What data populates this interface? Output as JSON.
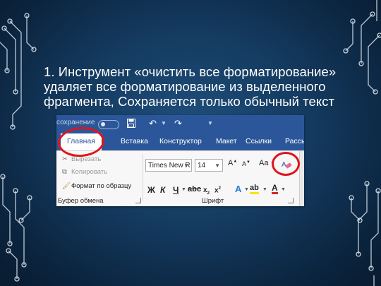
{
  "caption": {
    "line1": "1. Инструмент «очистить все форматирование»",
    "line2": "удаляет все форматирование из выделенного",
    "line3": "фрагмента, Сохраняется только обычный текст"
  },
  "word_ui": {
    "autosave_label": "сохранение",
    "tabs": [
      "Главная",
      "Вставка",
      "Конструктор",
      "Макет",
      "Ссылки",
      "Рассыл"
    ],
    "active_tab": "Главная",
    "clipboard": {
      "cut": "Вырезать",
      "copy": "Копировать",
      "format_painter": "Формат по образцу",
      "group_label": "Буфер обмена"
    },
    "font": {
      "font_name": "Times New R",
      "font_size": "14",
      "case_button": "Aa",
      "group_label": "Шрифт"
    }
  },
  "highlight_color": "#e0141b",
  "ribbon_accent": "#2b579a"
}
